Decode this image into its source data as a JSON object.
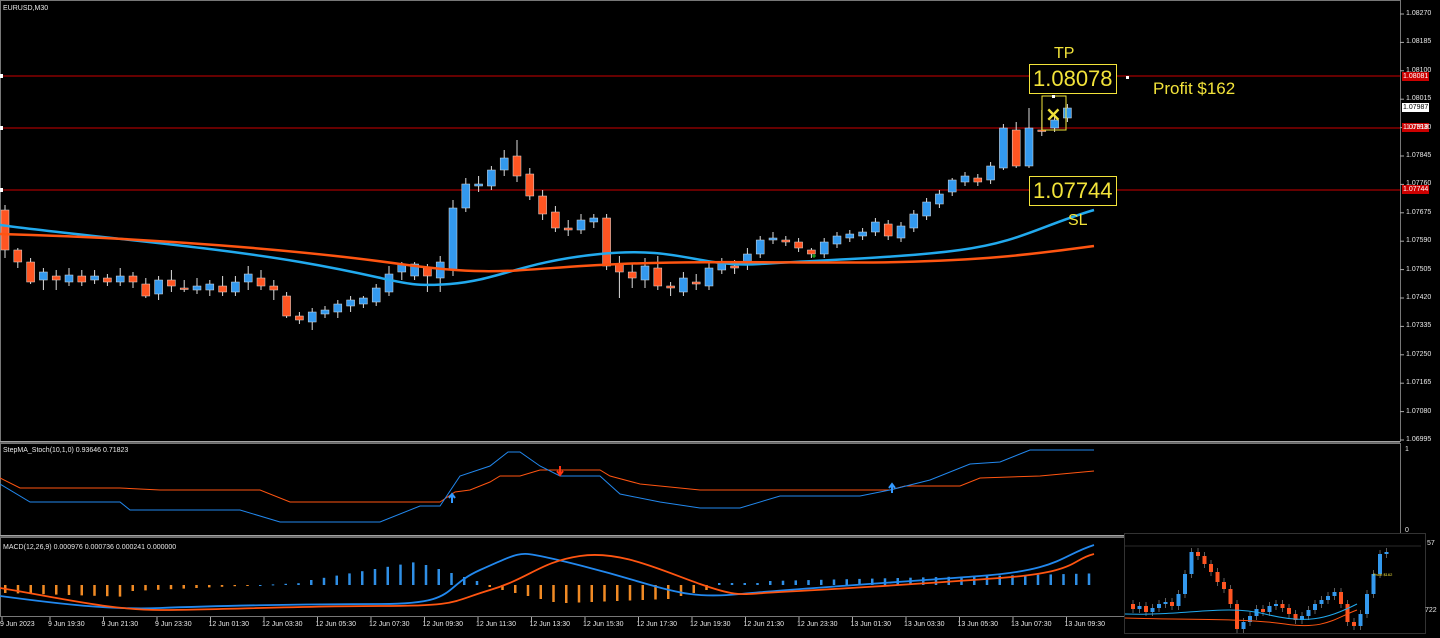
{
  "symbol": "EURUSD,M30",
  "trade": {
    "tp_label": "TP",
    "sl_label": "SL",
    "tp_price": "1.08078",
    "sl_price": "1.07744",
    "profit": "Profit $162",
    "close_mark": "×"
  },
  "price_axis": {
    "ticks": [
      "1.08270",
      "1.08185",
      "1.08100",
      "1.08015",
      "1.07930",
      "1.07845",
      "1.07760",
      "1.07675",
      "1.07590",
      "1.07505",
      "1.07420",
      "1.07335",
      "1.07250",
      "1.07165",
      "1.07080",
      "1.06995"
    ],
    "tp_tag": "1.08081",
    "current_tag": "1.07987",
    "entry_tag": "1.07918",
    "sl_tag": "1.07744"
  },
  "time_axis": [
    "9 Jun 2023",
    "9 Jun 19:30",
    "9 Jun 21:30",
    "9 Jun 23:30",
    "12 Jun 01:30",
    "12 Jun 03:30",
    "12 Jun 05:30",
    "12 Jun 07:30",
    "12 Jun 09:30",
    "12 Jun 11:30",
    "12 Jun 13:30",
    "12 Jun 15:30",
    "12 Jun 17:30",
    "12 Jun 19:30",
    "12 Jun 21:30",
    "12 Jun 23:30",
    "13 Jun 01:30",
    "13 Jun 03:30",
    "13 Jun 05:30",
    "13 Jun 07:30",
    "13 Jun 09:30"
  ],
  "stoch_panel": {
    "title": "StepMA_Stoch(10,1,0) 0.93646 0.71823",
    "axis_top": "1",
    "axis_bottom": "0"
  },
  "macd_panel": {
    "title": "MACD(12,26,9) 0.000976 0.000736 0.000241 0.000000"
  },
  "mini_chart": {
    "axis_top": "57",
    "axis_bottom": "722",
    "label": "Profit $162"
  },
  "colors": {
    "bull": "#3399ee",
    "bear": "#ff5522",
    "ma_fast": "#22aaee",
    "ma_slow": "#ff5511",
    "level": "#cc0000",
    "accent": "#f2e33a"
  }
}
